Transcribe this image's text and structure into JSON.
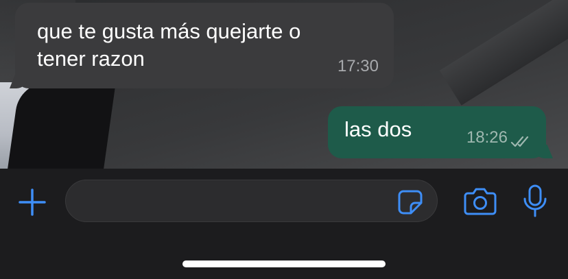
{
  "messages": [
    {
      "direction": "incoming",
      "text_line1": "que te gusta más quejarte o",
      "text_line2": "tener razon",
      "time": "17:30"
    },
    {
      "direction": "outgoing",
      "text": "las dos",
      "time": "18:26",
      "status": "read"
    }
  ],
  "composer": {
    "placeholder": "",
    "icons": {
      "attach": "plus-icon",
      "sticker": "sticker-icon",
      "camera": "camera-icon",
      "mic": "microphone-icon"
    }
  },
  "colors": {
    "incoming_bubble": "#3b3b3d",
    "outgoing_bubble": "#1e5b4a",
    "accent": "#3e8ef7",
    "background": "#1c1c1e"
  }
}
